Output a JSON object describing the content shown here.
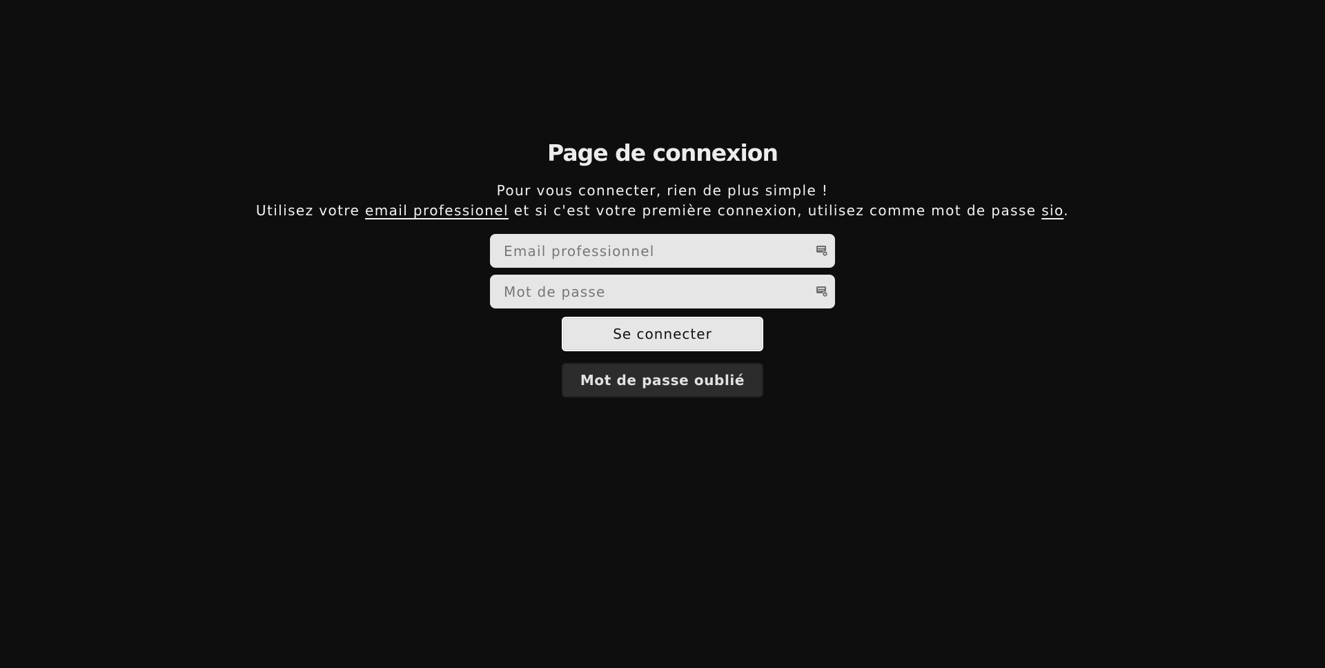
{
  "colors": {
    "background": "#0e0e0e",
    "input_background": "#e6e6e6",
    "login_button_background": "#e6e6e6",
    "forgot_button_background": "#2c2c2c",
    "text": "#eaeaea"
  },
  "login": {
    "title": "Page de connexion",
    "intro_line1": "Pour vous connecter, rien de plus simple !",
    "intro_line2_part1": "Utilisez votre ",
    "intro_line2_link1": "email professionel",
    "intro_line2_part2": " et si c'est votre première connexion, utilisez comme mot de passe ",
    "intro_line2_link2": "sio",
    "intro_line2_part3": ".",
    "email_field": {
      "placeholder": "Email professionnel",
      "value": "",
      "icon": "password-manager-autofill-icon"
    },
    "password_field": {
      "placeholder": "Mot de passe",
      "value": "",
      "icon": "password-manager-autofill-icon"
    },
    "submit_label": "Se connecter",
    "forgot_label": "Mot de passe oublié"
  }
}
